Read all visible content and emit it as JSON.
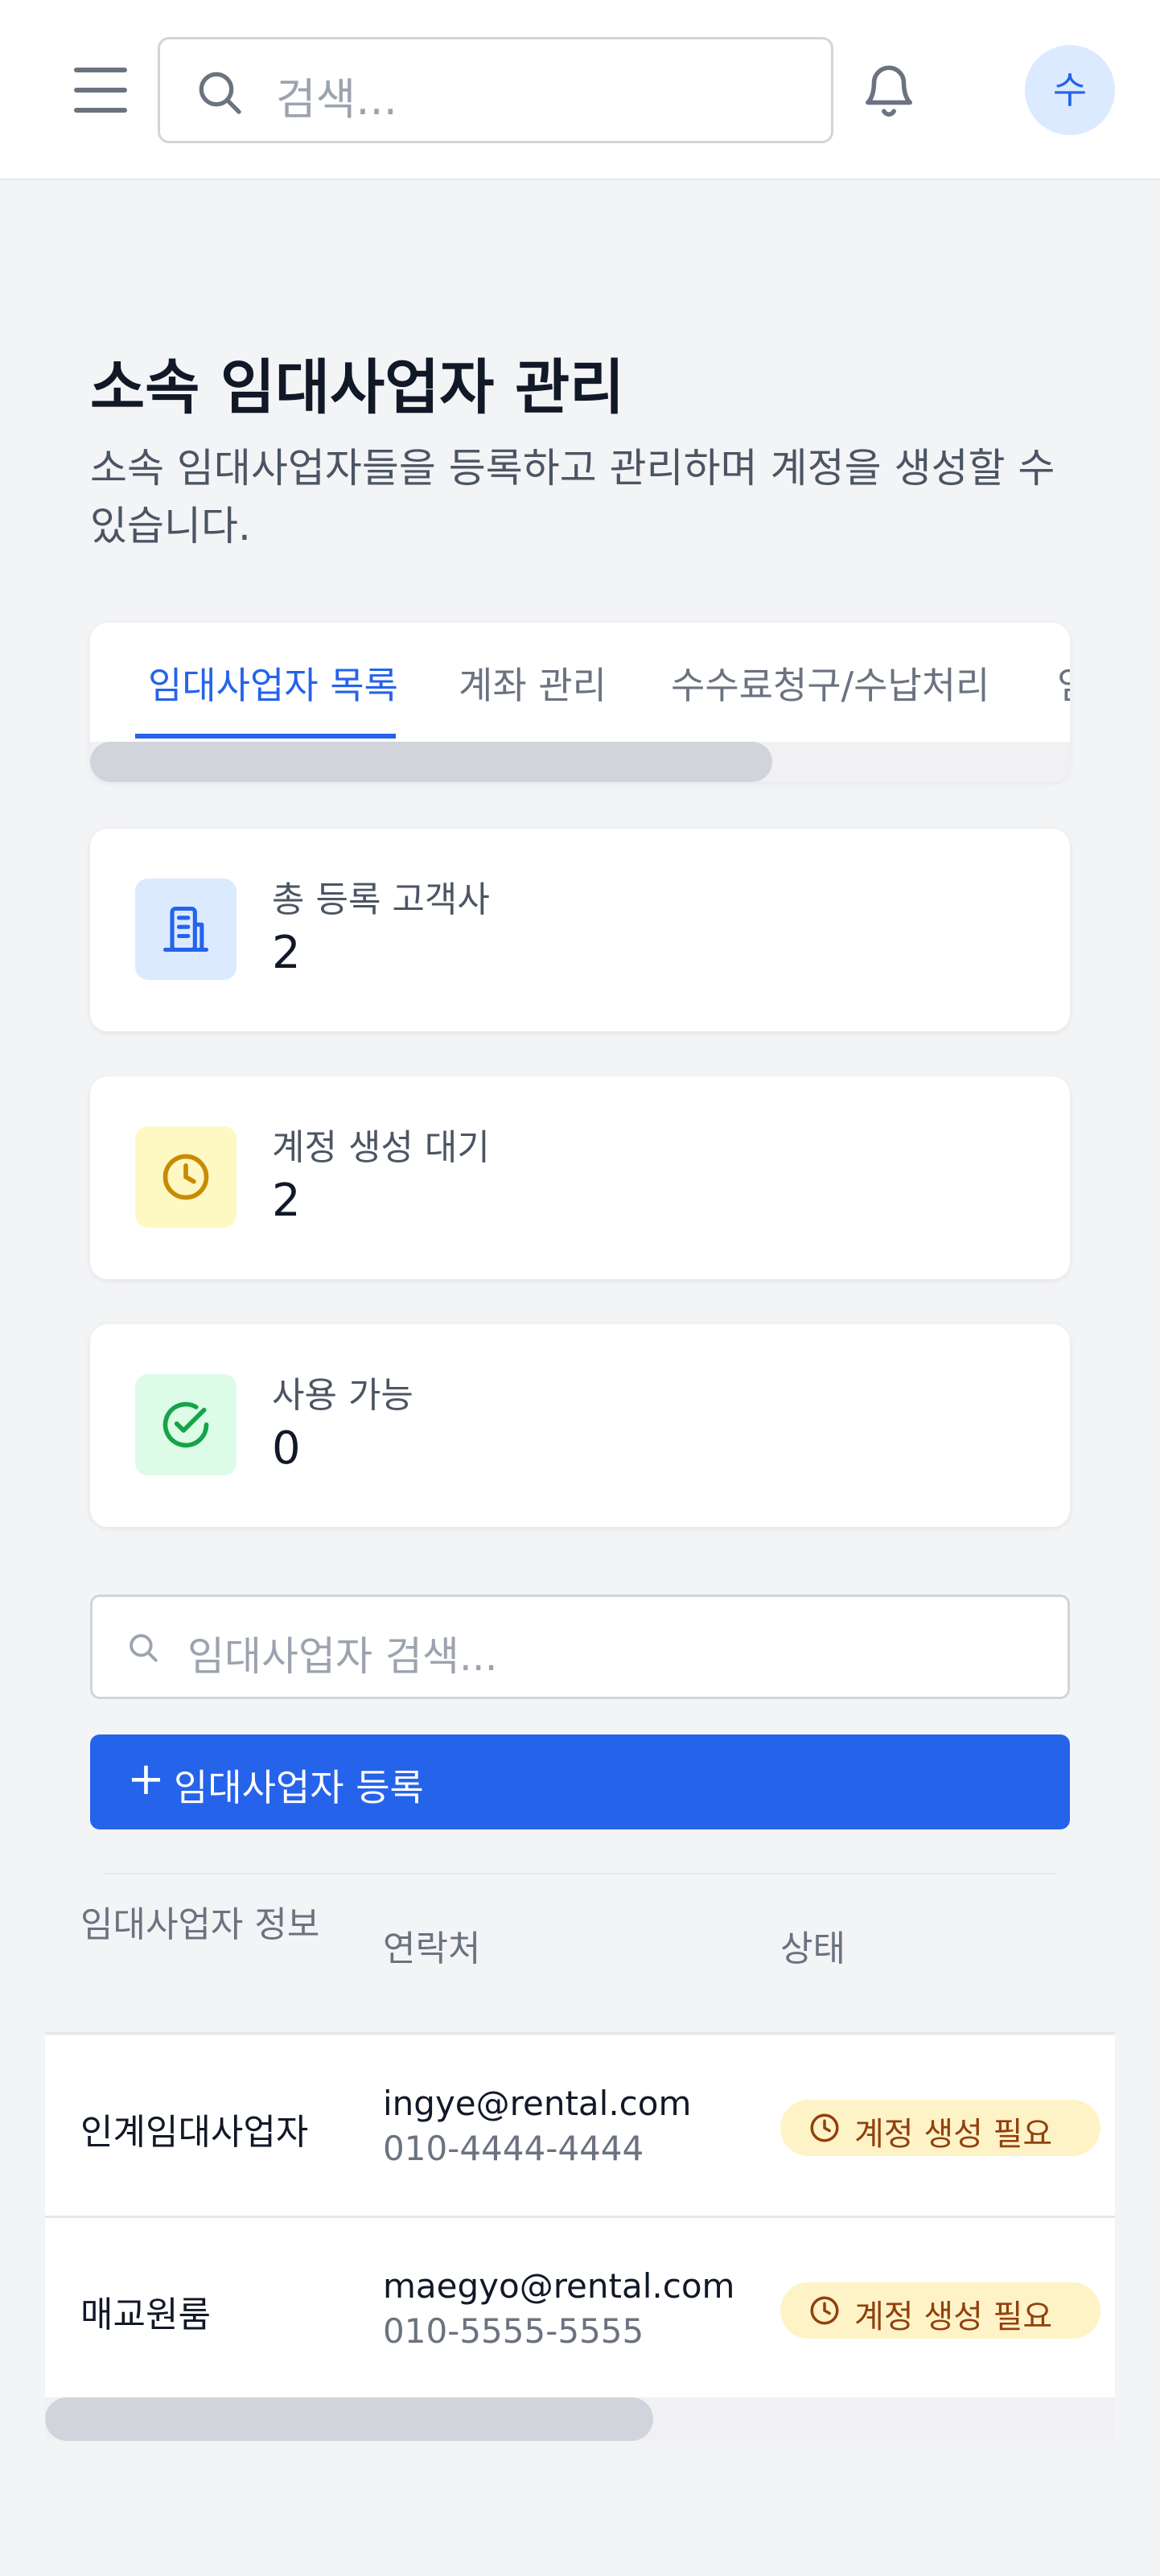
{
  "header": {
    "search_placeholder": "검색...",
    "avatar_initial": "수"
  },
  "page": {
    "title": "소속 임대사업자 관리",
    "description": "소속 임대사업자들을 등록하고 관리하며 계정을 생성할 수 있습니다."
  },
  "tabs": [
    {
      "label": "임대사업자 목록",
      "active": true
    },
    {
      "label": "계좌 관리",
      "active": false
    },
    {
      "label": "수수료청구/수납처리",
      "active": false
    },
    {
      "label": "임",
      "active": false
    }
  ],
  "stats": [
    {
      "label": "총 등록 고객사",
      "value": "2",
      "icon": "building-icon",
      "color": "#2563eb",
      "bg": "#dbeafe"
    },
    {
      "label": "계정 생성 대기",
      "value": "2",
      "icon": "clock-icon",
      "color": "#ca8a04",
      "bg": "#fef9c3"
    },
    {
      "label": "사용 가능",
      "value": "0",
      "icon": "check-circle-icon",
      "color": "#16a34a",
      "bg": "#dcfce7"
    }
  ],
  "list_search": {
    "placeholder": "임대사업자 검색..."
  },
  "register_button": {
    "plus": "+",
    "label": "임대사업자 등록"
  },
  "table": {
    "headers": [
      "임대사업자 정보",
      "연락처",
      "상태"
    ],
    "rows": [
      {
        "name": "인계임대사업자",
        "email": "ingye@rental.com",
        "phone": "010-4444-4444",
        "status": "계정 생성 필요"
      },
      {
        "name": "매교원룸",
        "email": "maegyo@rental.com",
        "phone": "010-5555-5555",
        "status": "계정 생성 필요"
      }
    ]
  },
  "colors": {
    "accent": "#2563eb",
    "warning_bg": "#fef3c7",
    "warning_text": "#92400e"
  }
}
